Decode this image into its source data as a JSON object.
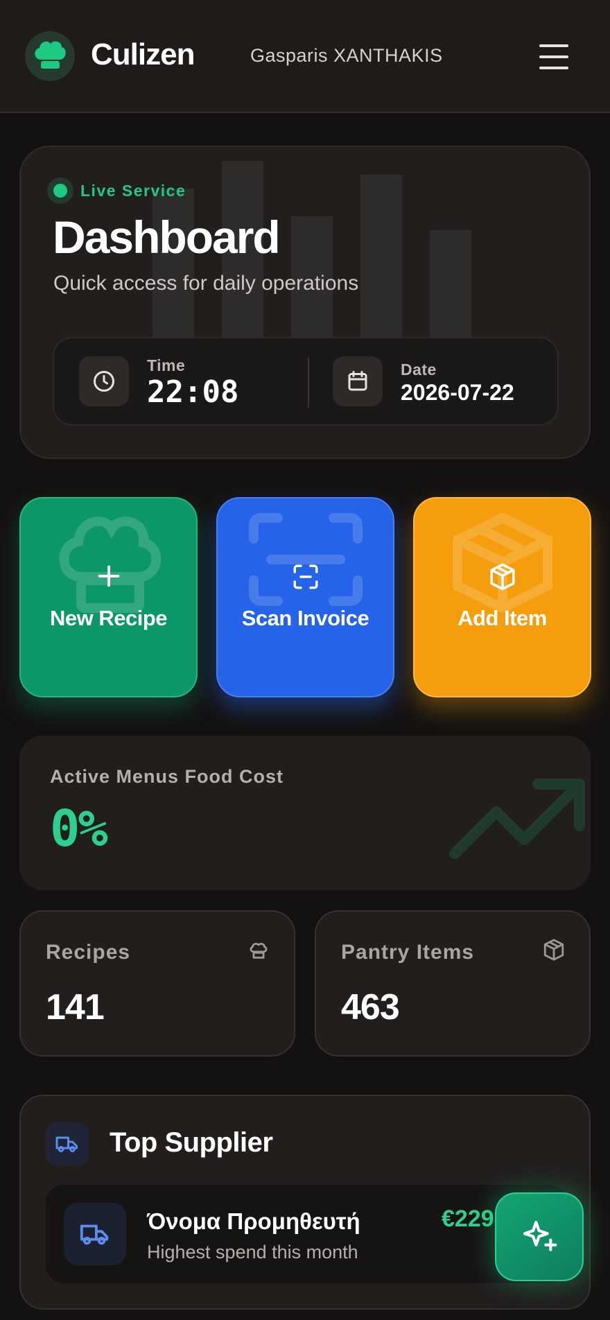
{
  "header": {
    "brand": "Culizen",
    "user_name": "Gasparis XANTHAKIS",
    "logo_icon": "chef-hat-icon",
    "menu_icon": "hamburger-menu-icon"
  },
  "hero": {
    "status_label": "Live Service",
    "title": "Dashboard",
    "subtitle": "Quick access for daily operations",
    "time_label": "Time",
    "time_value": "22:08",
    "date_label": "Date",
    "date_value": "2026-07-22"
  },
  "actions": [
    {
      "label": "New Recipe",
      "icon": "plus-icon",
      "color": "#0b9768"
    },
    {
      "label": "Scan Invoice",
      "icon": "scan-icon",
      "color": "#2563e8"
    },
    {
      "label": "Add Item",
      "icon": "box-icon",
      "color": "#f59d0c"
    }
  ],
  "food_cost": {
    "label": "Active Menus Food Cost",
    "value": "0%"
  },
  "stats": {
    "recipes_label": "Recipes",
    "recipes_value": "141",
    "pantry_label": "Pantry Items",
    "pantry_value": "463"
  },
  "supplier": {
    "title": "Top Supplier",
    "name": "Όνομα Προμηθευτή",
    "description": "Highest spend this month",
    "amount": "€229"
  },
  "colors": {
    "accent": "#1ec983",
    "background": "#141211",
    "card": "#211e1c"
  }
}
